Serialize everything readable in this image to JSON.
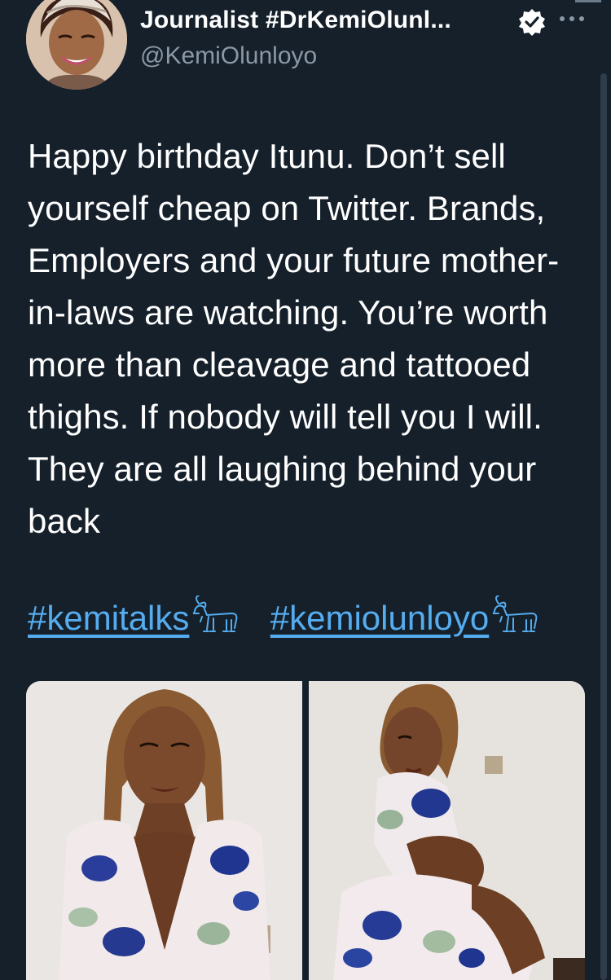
{
  "author": {
    "display_name": "Journalist #DrKemiOlunl...",
    "handle": "@KemiOlunloyo",
    "avatar_icon": "avatar-photo",
    "verified_icon": "verified-badge-icon",
    "more_icon": "more-options-icon"
  },
  "tweet": {
    "text": "Happy birthday Itunu. Don’t sell yourself cheap on Twitter. Brands, Employers and your future mother-in-laws are watching. You’re worth more than cleavage and tattooed thighs. If nobody will tell you I will. They are all laughing behind your back",
    "hashtags": [
      "#kemitalks",
      "#kemiolunloyo"
    ],
    "hashtag_emoji": "goat-emoji-icon"
  },
  "media": {
    "images": [
      {
        "name": "photo-left",
        "description_icon": "photo"
      },
      {
        "name": "photo-right",
        "description_icon": "photo"
      }
    ]
  },
  "colors": {
    "background": "#15202b",
    "text": "#ffffff",
    "secondary_text": "#8b98a5",
    "link": "#55acee"
  }
}
